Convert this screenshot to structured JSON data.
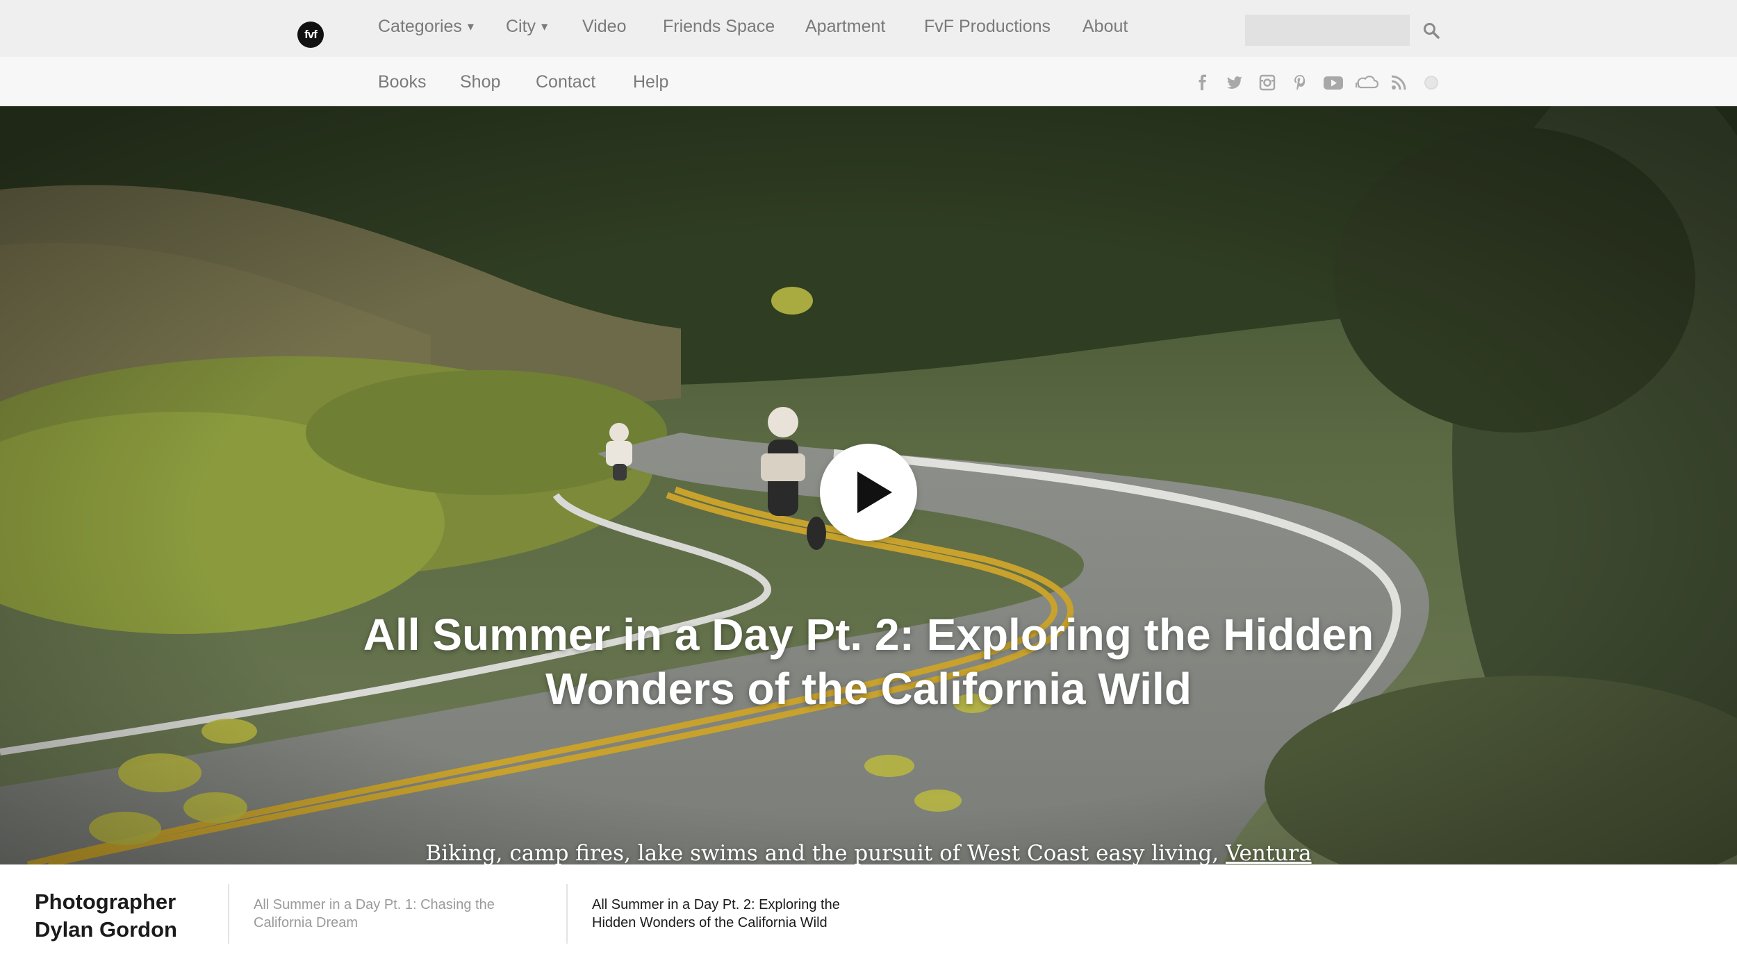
{
  "header": {
    "logo_text": "fvf",
    "nav": [
      {
        "label": "Categories",
        "has_dropdown": true
      },
      {
        "label": "City",
        "has_dropdown": true
      },
      {
        "label": "Video",
        "has_dropdown": false
      },
      {
        "label": "Friends Space",
        "has_dropdown": false
      },
      {
        "label": "Apartment",
        "has_dropdown": false
      },
      {
        "label": "FvF Productions",
        "has_dropdown": false
      },
      {
        "label": "About",
        "has_dropdown": false
      }
    ],
    "dropdown_glyph": "▾",
    "search": {
      "value": "",
      "placeholder": "",
      "icon": "search-icon"
    }
  },
  "subnav": {
    "items": [
      "Books",
      "Shop",
      "Contact",
      "Help"
    ],
    "social_icons": [
      "facebook-icon",
      "twitter-icon",
      "instagram-icon",
      "pinterest-icon",
      "youtube-icon",
      "soundcloud-icon",
      "rss-icon",
      "circle-icon"
    ]
  },
  "hero": {
    "title": "All Summer in a Day Pt. 2: Exploring the Hidden Wonders of the California Wild",
    "subtitle": "Biking, camp fires, lake swims and the pursuit of West Coast easy living,",
    "location_link": "Ventura",
    "play_icon": "play-icon"
  },
  "footer_strip": {
    "credit_line1": "Photographer",
    "credit_line2": "Dylan Gordon",
    "related": [
      {
        "label": "All Summer in a Day Pt. 1: Chasing the California Dream",
        "active": false
      },
      {
        "label": "All Summer in a Day Pt. 2: Exploring the Hidden Wonders of the California Wild",
        "active": true
      }
    ]
  },
  "colors": {
    "topbar_bg": "#efefef",
    "subbar_bg": "#f7f7f7",
    "nav_text": "#7a7a7a",
    "inactive_related": "#9a9a9a",
    "active_related": "#1b1b1b"
  }
}
